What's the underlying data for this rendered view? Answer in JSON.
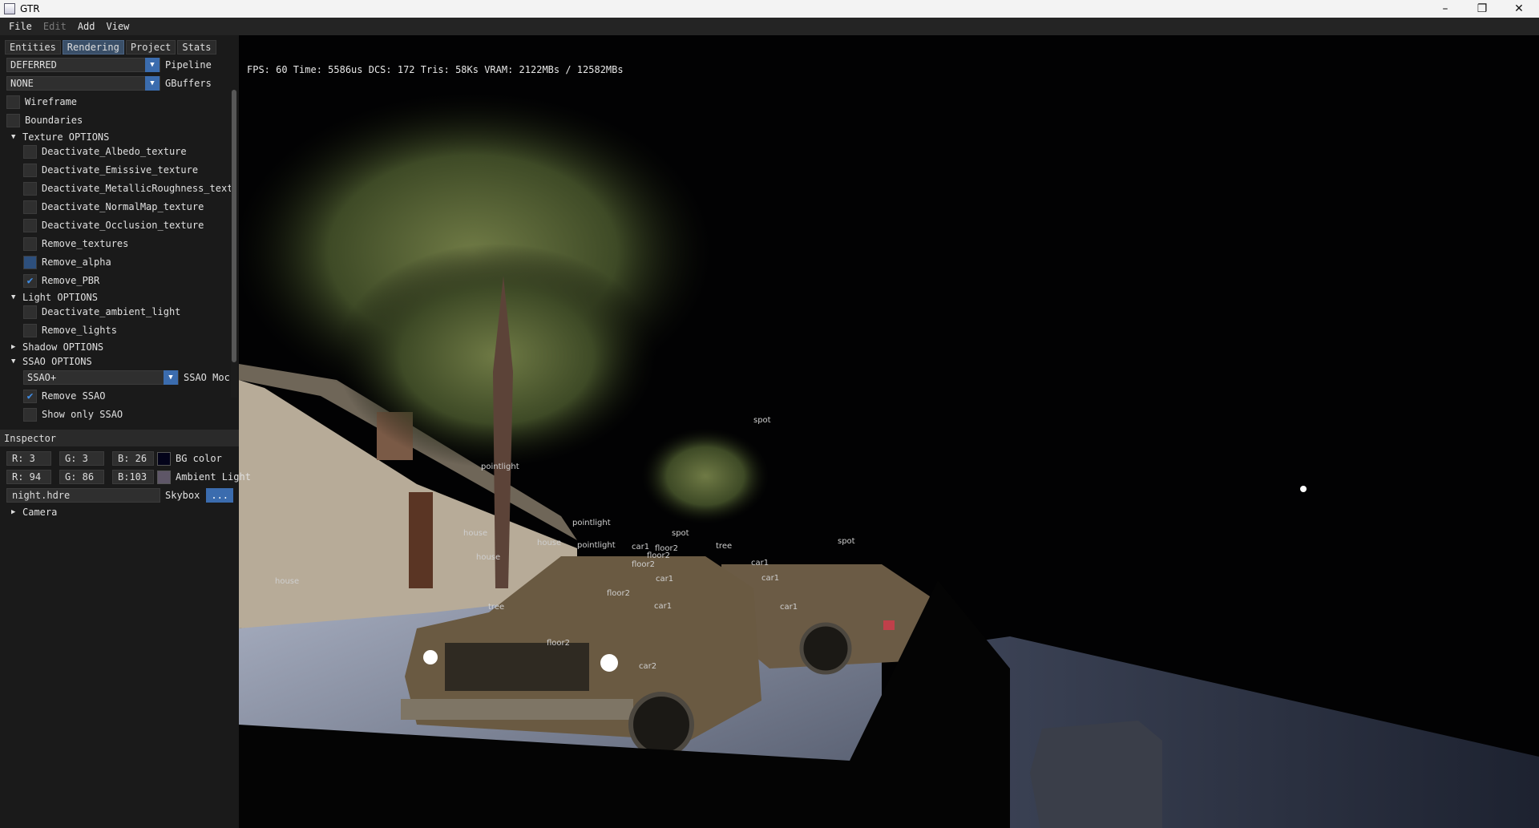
{
  "window": {
    "title": "GTR",
    "controls": [
      "–",
      "❐",
      "✕"
    ]
  },
  "menu": [
    {
      "label": "File",
      "enabled": true
    },
    {
      "label": "Edit",
      "enabled": false
    },
    {
      "label": "Add",
      "enabled": true
    },
    {
      "label": "View",
      "enabled": true
    }
  ],
  "tabs": [
    "Entities",
    "Rendering",
    "Project",
    "Stats"
  ],
  "rendering": {
    "pipeline": {
      "value": "DEFERRED",
      "label": "Pipeline"
    },
    "gbuffers": {
      "value": "NONE",
      "label": "GBuffers"
    },
    "wireframe": "Wireframe",
    "boundaries": "Boundaries",
    "texture_options": {
      "title": "Texture OPTIONS",
      "items": [
        {
          "label": "Deactivate_Albedo_texture",
          "checked": false
        },
        {
          "label": "Deactivate_Emissive_texture",
          "checked": false
        },
        {
          "label": "Deactivate_MetallicRoughness_text",
          "checked": false
        },
        {
          "label": "Deactivate_NormalMap_texture",
          "checked": false
        },
        {
          "label": "Deactivate_Occlusion_texture",
          "checked": false
        },
        {
          "label": "Remove_textures",
          "checked": false
        },
        {
          "label": "Remove_alpha",
          "checked": false
        },
        {
          "label": "Remove_PBR",
          "checked": true
        }
      ]
    },
    "light_options": {
      "title": "Light OPTIONS",
      "items": [
        {
          "label": "Deactivate_ambient_light",
          "checked": false
        },
        {
          "label": "Remove_lights",
          "checked": false
        }
      ]
    },
    "shadow_options": {
      "title": "Shadow OPTIONS"
    },
    "ssao_options": {
      "title": "SSAO OPTIONS",
      "mode_value": "SSAO+",
      "mode_label": "SSAO Moc",
      "remove": {
        "label": "Remove SSAO",
        "checked": true
      },
      "show_only": {
        "label": "Show only SSAO",
        "checked": false
      }
    }
  },
  "inspector": {
    "title": "Inspector",
    "bg_color": {
      "r": "R:  3",
      "g": "G:  3",
      "b": "B: 26",
      "label": "BG color",
      "hex": "#03031a"
    },
    "ambient": {
      "r": "R: 94",
      "g": "G: 86",
      "b": "B:103",
      "label": "Ambient Light",
      "hex": "#5e5667"
    },
    "skybox": {
      "value": "night.hdre",
      "label": "Skybox",
      "button": "..."
    },
    "camera": "Camera"
  },
  "stats": "FPS: 60 Time: 5586us DCS: 172 Tris: 58Ks  VRAM: 2122MBs / 12582MBs",
  "scene_labels": [
    "spot",
    "pointlight",
    "house",
    "house",
    "house",
    "house",
    "pointlight",
    "pointlight",
    "spot",
    "tree",
    "car1",
    "car1",
    "car1",
    "floor2",
    "floor2",
    "floor2",
    "car1",
    "floor2",
    "car1",
    "tree",
    "spot",
    "car1",
    "floor2",
    "car2"
  ]
}
